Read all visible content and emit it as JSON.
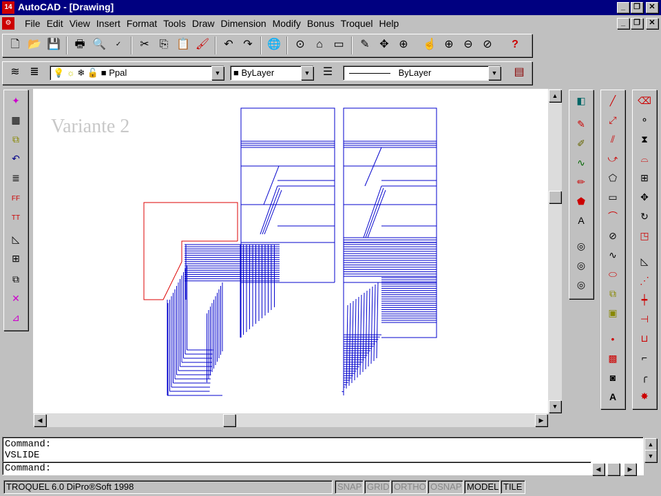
{
  "app": {
    "title": "AutoCAD - [Drawing]"
  },
  "menu": [
    "File",
    "Edit",
    "View",
    "Insert",
    "Format",
    "Tools",
    "Draw",
    "Dimension",
    "Modify",
    "Bonus",
    "Troquel",
    "Help"
  ],
  "layer": {
    "name": "Ppal",
    "color_label": "ByLayer",
    "linetype_label": "ByLayer"
  },
  "drawing": {
    "watermark": "Variante 2",
    "line_color": "#0000cc",
    "profile_color": "#dd0000"
  },
  "command": {
    "line1": "Command:",
    "line2": "VSLIDE",
    "prompt": "Command:"
  },
  "status": {
    "app_label": "TROQUEL 6.0 DiPro®Soft 1998",
    "snap": "SNAP",
    "grid": "GRID",
    "ortho": "ORTHO",
    "osnap": "OSNAP",
    "model": "MODEL",
    "tile": "TILE"
  }
}
